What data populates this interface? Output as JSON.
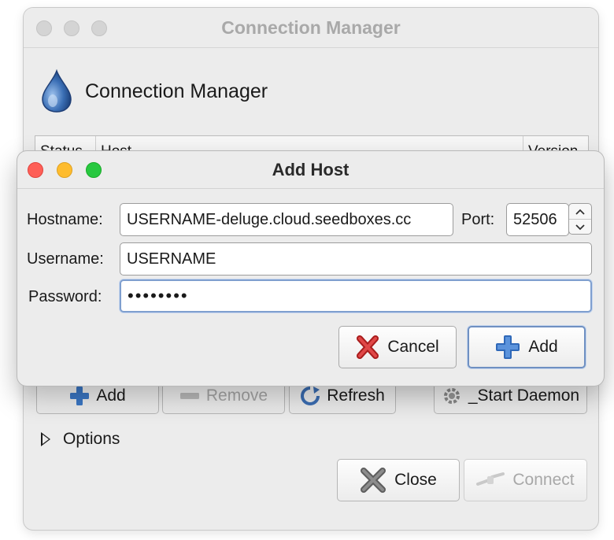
{
  "connection_manager": {
    "window_title": "Connection Manager",
    "header_title": "Connection Manager",
    "columns": [
      "Status",
      "Host",
      "Version"
    ],
    "buttons": {
      "add": "Add",
      "remove": "Remove",
      "refresh": "Refresh",
      "start_daemon": "_Start Daemon"
    },
    "options_label": "Options",
    "close_label": "Close",
    "connect_label": "Connect"
  },
  "add_host": {
    "title": "Add Host",
    "hostname_label": "Hostname:",
    "hostname_value": "USERNAME-deluge.cloud.seedboxes.cc",
    "port_label": "Port:",
    "port_value": "52506",
    "username_label": "Username:",
    "username_value": "USERNAME",
    "password_label": "Password:",
    "password_value": "••••••••",
    "cancel_label": "Cancel",
    "add_label": "Add"
  },
  "icons": {
    "app_logo": "deluge-drop-icon",
    "cancel": "red-x-icon",
    "add": "blue-plus-icon",
    "close": "gray-x-icon",
    "refresh": "refresh-icon",
    "start_daemon": "gear-icon",
    "connect": "plug-icon"
  },
  "colors": {
    "traffic_red": "#fe5f57",
    "traffic_yellow": "#febc2e",
    "traffic_green": "#28c840",
    "focus_blue": "#7f9fcf"
  }
}
